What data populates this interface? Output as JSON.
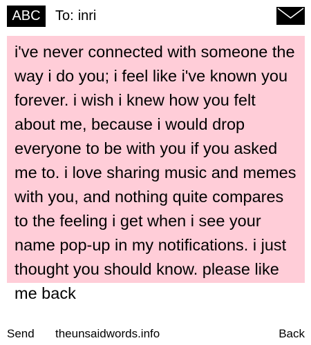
{
  "header": {
    "mode_badge": "ABC",
    "to_label": "To:",
    "recipient": "inri",
    "envelope_icon": "envelope-icon"
  },
  "message": {
    "background_color": "#ffcdd8",
    "text": "i've never connected with someone the way i do you; i feel like i've known you forever. i wish i knew how you felt about me, because i would drop everyone to be with you if you asked me to. i love sharing music and memes with you, and nothing quite compares to the feeling i get when i see your name pop-up in my notifications. i just thought you should know. please like me back"
  },
  "footer": {
    "send_label": "Send",
    "site": "theunsaidwords.info",
    "back_label": "Back"
  }
}
